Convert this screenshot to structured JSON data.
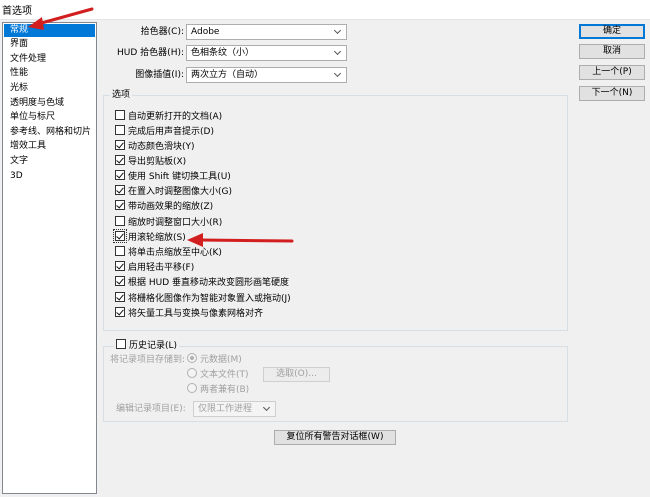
{
  "window": {
    "title": "首选项"
  },
  "categories": [
    "常规",
    "界面",
    "文件处理",
    "性能",
    "光标",
    "透明度与色域",
    "单位与标尺",
    "参考线、网格和切片",
    "增效工具",
    "文字",
    "3D"
  ],
  "selected_category": "常规",
  "pickers": {
    "color_picker": {
      "label": "拾色器(C):",
      "value": "Adobe"
    },
    "hud_picker": {
      "label": "HUD 拾色器(H):",
      "value": "色相条纹（小）"
    },
    "interpolation": {
      "label": "图像插值(I):",
      "value": "两次立方（自动）"
    }
  },
  "options_group": {
    "title": "选项",
    "items": [
      {
        "label": "自动更新打开的文档(A)",
        "checked": false
      },
      {
        "label": "完成后用声音提示(D)",
        "checked": false
      },
      {
        "label": "动态颜色滑块(Y)",
        "checked": true
      },
      {
        "label": "导出剪贴板(X)",
        "checked": true
      },
      {
        "label": "使用 Shift 键切换工具(U)",
        "checked": true
      },
      {
        "label": "在置入时调整图像大小(G)",
        "checked": true
      },
      {
        "label": "带动画效果的缩放(Z)",
        "checked": true
      },
      {
        "label": "缩放时调整窗口大小(R)",
        "checked": false
      },
      {
        "label": "用滚轮缩放(S)",
        "checked": true
      },
      {
        "label": "将单击点缩放至中心(K)",
        "checked": false
      },
      {
        "label": "启用轻击平移(F)",
        "checked": true
      },
      {
        "label": "根据 HUD 垂直移动来改变圆形画笔硬度",
        "checked": true
      },
      {
        "label": "将栅格化图像作为智能对象置入或拖动(J)",
        "checked": true
      },
      {
        "label": "将矢量工具与变换与像素网格对齐",
        "checked": true
      }
    ]
  },
  "history_group": {
    "title": "历史记录(L)",
    "save_to_label": "将记录项目存储到:",
    "radios": [
      {
        "label": "元数据(M)",
        "selected": true
      },
      {
        "label": "文本文件(T)",
        "selected": false
      },
      {
        "label": "两者兼有(B)",
        "selected": false
      }
    ],
    "choose_button": "选取(O)...",
    "edit_log_label": "编辑记录项目(E):",
    "edit_log_value": "仅限工作进程"
  },
  "reset_warnings_button": "复位所有警告对话框(W)",
  "buttons": {
    "ok": "确定",
    "cancel": "取消",
    "prev": "上一个(P)",
    "next": "下一个(N)"
  },
  "colors": {
    "selection": "#0078d7",
    "annotation_arrow": "#d21e1e"
  }
}
